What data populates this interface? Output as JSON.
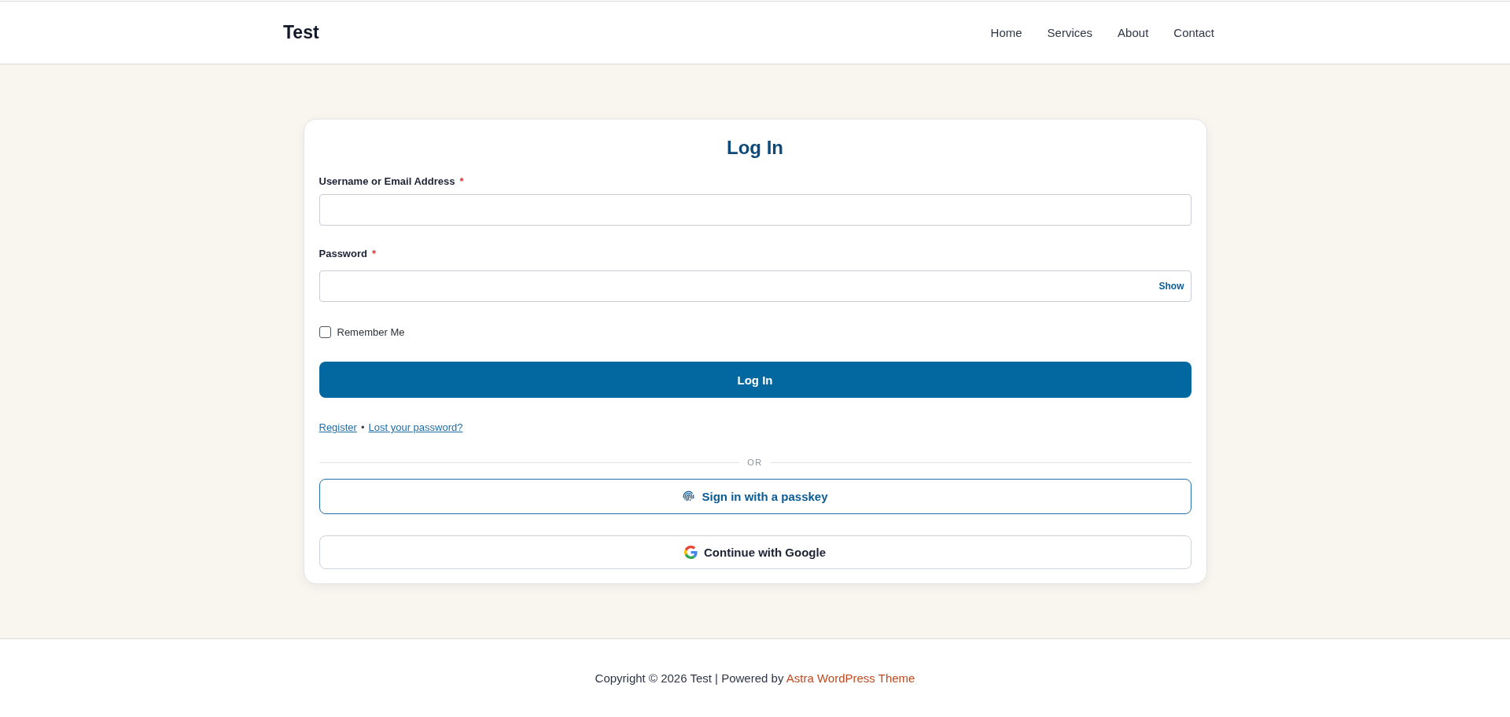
{
  "header": {
    "site_title": "Test",
    "nav": [
      {
        "label": "Home"
      },
      {
        "label": "Services"
      },
      {
        "label": "About"
      },
      {
        "label": "Contact"
      }
    ]
  },
  "login": {
    "title": "Log In",
    "fields": [
      {
        "kind": "text",
        "label": "Username or Email Address",
        "required_mark": "*"
      },
      {
        "kind": "password",
        "label": "Password",
        "required_mark": "*",
        "toggle": "Show"
      }
    ],
    "remember": {
      "label": "Remember Me",
      "checked": false
    },
    "submit": "Log In",
    "links": [
      {
        "label": "Register"
      },
      {
        "label": "Lost your password?"
      }
    ],
    "link_separator": "•",
    "divider": "OR",
    "alt_buttons": [
      {
        "kind": "passkey",
        "label": "Sign in with a passkey"
      },
      {
        "kind": "google",
        "label": "Continue with Google"
      }
    ]
  },
  "footer": {
    "text": "Copyright © 2026 Test | Powered by",
    "link": "Astra WordPress Theme"
  }
}
